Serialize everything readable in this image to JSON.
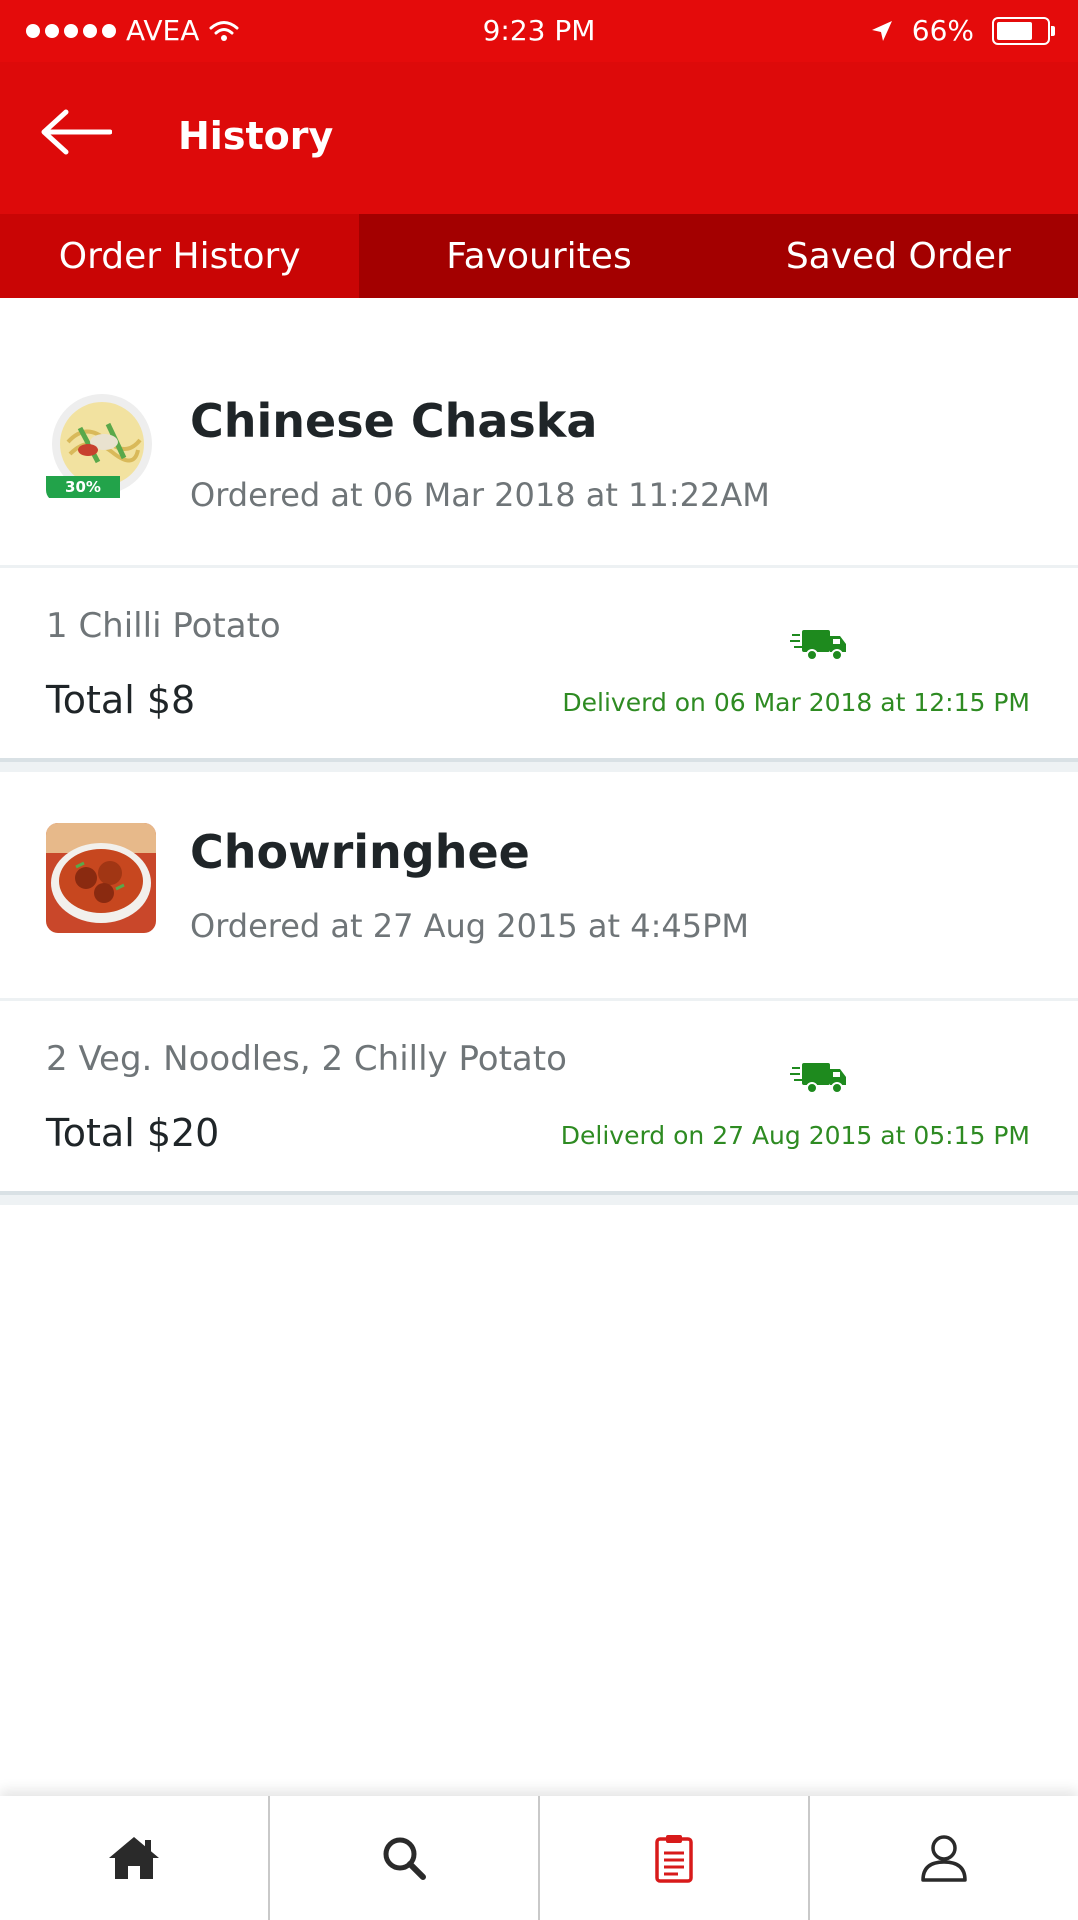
{
  "status_bar": {
    "carrier": "AVEA",
    "time": "9:23 PM",
    "battery_text": "66%",
    "battery_level": 0.66
  },
  "header": {
    "title": "History",
    "back_icon": "back-arrow-icon"
  },
  "tabs": [
    {
      "label": "Order History",
      "active": true
    },
    {
      "label": "Favourites",
      "active": false
    },
    {
      "label": "Saved Order",
      "active": false
    }
  ],
  "orders": [
    {
      "restaurant": "Chinese Chaska",
      "ordered_at": "Ordered at 06 Mar 2018 at 11:22AM",
      "badge": "30% OFF",
      "items": "1 Chilli Potato",
      "total": "Total $8",
      "delivered": "Deliverd on 06 Mar 2018 at 12:15 PM"
    },
    {
      "restaurant": "Chowringhee",
      "ordered_at": "Ordered at 27 Aug 2015 at 4:45PM",
      "items": "2 Veg. Noodles, 2 Chilly Potato",
      "total": "Total $20",
      "delivered": "Deliverd on 27 Aug 2015 at 05:15 PM"
    }
  ],
  "bottom_nav": [
    {
      "icon": "home-icon",
      "active": false
    },
    {
      "icon": "search-icon",
      "active": false
    },
    {
      "icon": "clipboard-icon",
      "active": true
    },
    {
      "icon": "profile-icon",
      "active": false
    }
  ],
  "colors": {
    "primary": "#dd0a0a",
    "tab_bar": "#a30000",
    "delivered_text": "#2e8b22",
    "active_nav": "#d81a1a"
  }
}
